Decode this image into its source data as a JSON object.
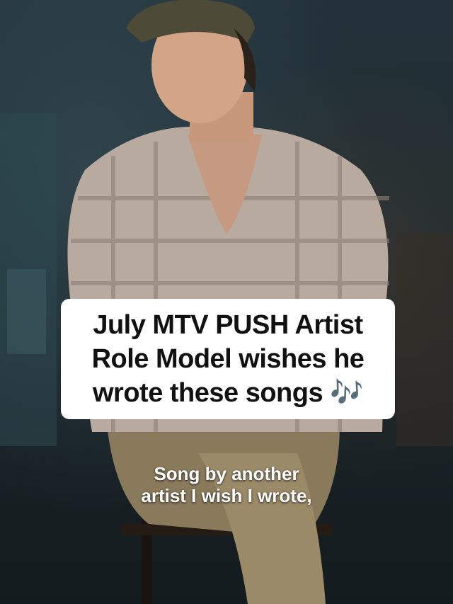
{
  "title_card": {
    "text": "July MTV PUSH Artist\nRole Model wishes he\nwrote these songs 🎶"
  },
  "caption": {
    "line1": "Song by another",
    "line2": "artist I wish I wrote,"
  }
}
